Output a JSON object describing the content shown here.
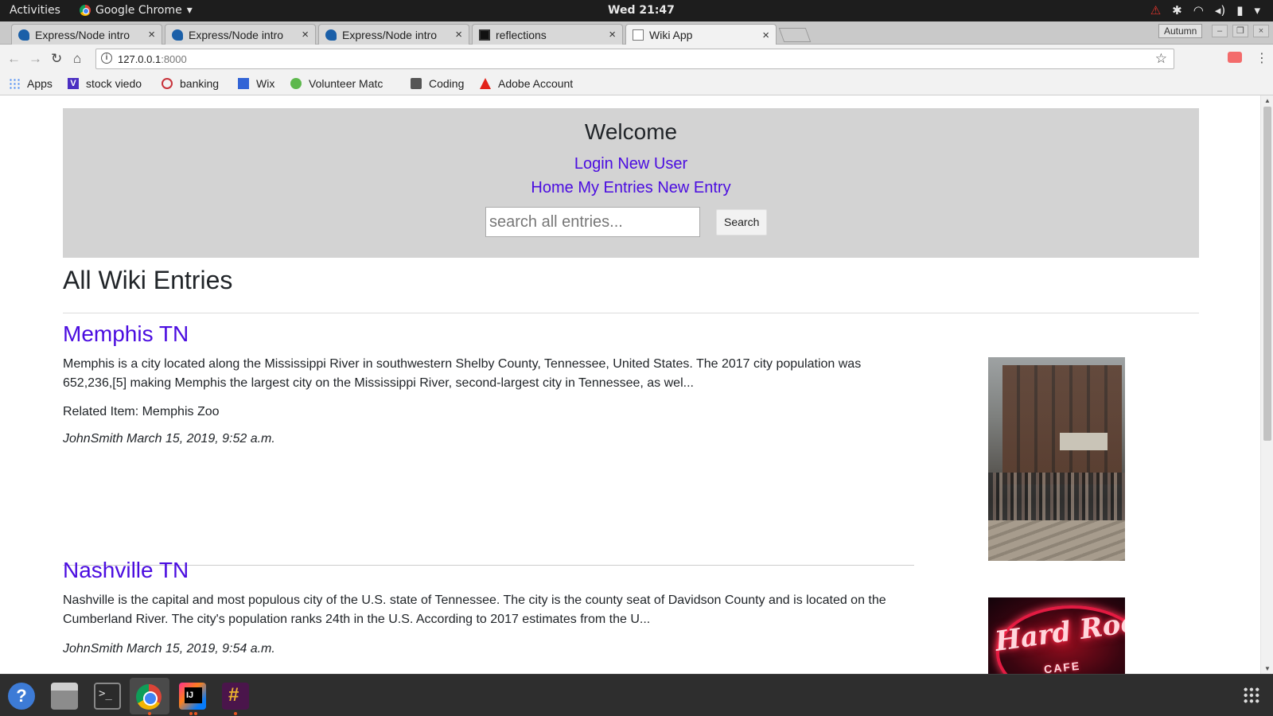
{
  "system_bar": {
    "activities": "Activities",
    "app_name": "Google Chrome",
    "app_menu_arrow": "▾",
    "clock": "Wed 21:47",
    "tray_icons": [
      "warning-icon",
      "slack-tray-icon",
      "wifi-icon",
      "volume-icon",
      "battery-icon",
      "chevron-down-icon"
    ]
  },
  "tabs": [
    {
      "title": "Express/Node intro",
      "favicon": "node-favicon",
      "active": false
    },
    {
      "title": "Express/Node intro",
      "favicon": "node-favicon",
      "active": false
    },
    {
      "title": "Express/Node intro",
      "favicon": "node-favicon",
      "active": false
    },
    {
      "title": "reflections",
      "favicon": "intellij-favicon",
      "active": false
    },
    {
      "title": "Wiki App",
      "favicon": "document-favicon",
      "active": true
    }
  ],
  "profile_name": "Autumn",
  "omnibox": {
    "host": "127.0.0.1",
    "port": ":8000"
  },
  "bookmarks": [
    {
      "label": "Apps",
      "icon": "apps-grid-icon"
    },
    {
      "label": "stock viedo",
      "icon": "vimeo-icon"
    },
    {
      "label": "banking",
      "icon": "bank-icon"
    },
    {
      "label": "Wix",
      "icon": "wix-icon"
    },
    {
      "label": "Volunteer Matc",
      "icon": "volunteer-icon"
    },
    {
      "label": "Coding",
      "icon": "folder-icon"
    },
    {
      "label": "Adobe Account",
      "icon": "adobe-icon"
    }
  ],
  "page": {
    "header": {
      "welcome": "Welcome",
      "login": "Login",
      "new_user": "New User",
      "home": "Home",
      "my_entries": "My Entries",
      "new_entry": "New Entry",
      "search_placeholder": "search all entries...",
      "search_button": "Search"
    },
    "heading": "All Wiki Entries",
    "entries": [
      {
        "title": "Memphis TN",
        "description": "Memphis is a city located along the Mississippi River in southwestern Shelby County, Tennessee, United States. The 2017 city population was 652,236,[5] making Memphis the largest city on the Mississippi River, second-largest city in Tennessee, as wel...",
        "related": "Related Item: Memphis Zoo",
        "meta": "JohnSmith March 15, 2019, 9:52 a.m.",
        "image": "memphis-street-photo"
      },
      {
        "title": "Nashville TN",
        "description": "Nashville is the capital and most populous city of the U.S. state of Tennessee. The city is the county seat of Davidson County and is located on the Cumberland River. The city's population ranks 24th in the U.S. According to 2017 estimates from the U...",
        "meta": "JohnSmith March 15, 2019, 9:54 a.m.",
        "image": "hard-rock-cafe-photo",
        "image_text": "Hard Rock",
        "image_subtext": "CAFE"
      }
    ]
  },
  "dock": [
    {
      "name": "help-icon",
      "glyph": "?"
    },
    {
      "name": "files-icon"
    },
    {
      "name": "terminal-icon",
      "glyph": ">_"
    },
    {
      "name": "chrome-icon"
    },
    {
      "name": "intellij-icon"
    },
    {
      "name": "slack-icon"
    }
  ],
  "colors": {
    "link": "#4b0de0",
    "jumbotron_bg": "#d3d3d3",
    "top_bar": "#1d1d1d",
    "accent_orange": "#e95420"
  }
}
